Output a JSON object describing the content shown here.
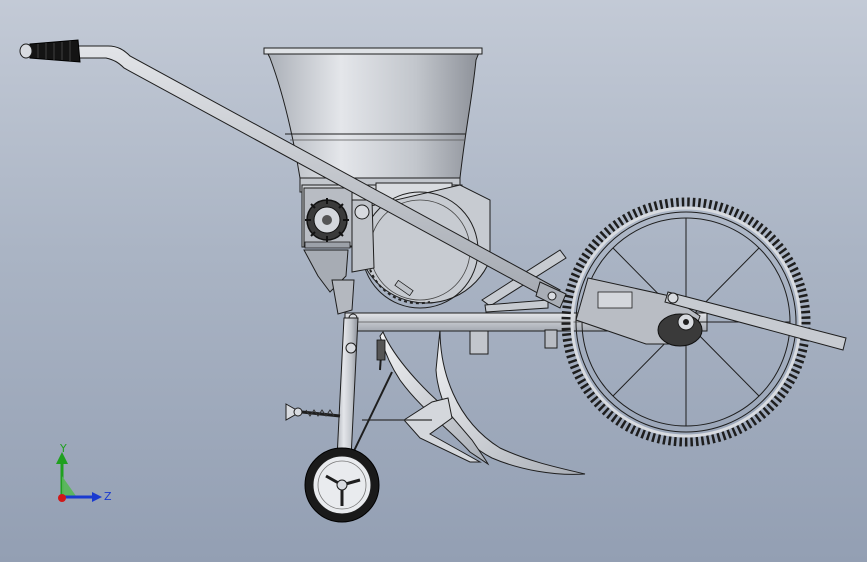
{
  "viewport": {
    "background_top": "#c3cad6",
    "background_bottom": "#939fb3"
  },
  "model": {
    "description_icon": "seeder-planter-3d-model",
    "metal_color": "#c9cdd3",
    "edge_color": "#1e1e1e",
    "grip_color": "#151515"
  },
  "triad": {
    "y_label": "Y",
    "z_label": "Z",
    "y_color": "#20a020",
    "z_color": "#1a3ad0",
    "x_color": "#d01818"
  }
}
